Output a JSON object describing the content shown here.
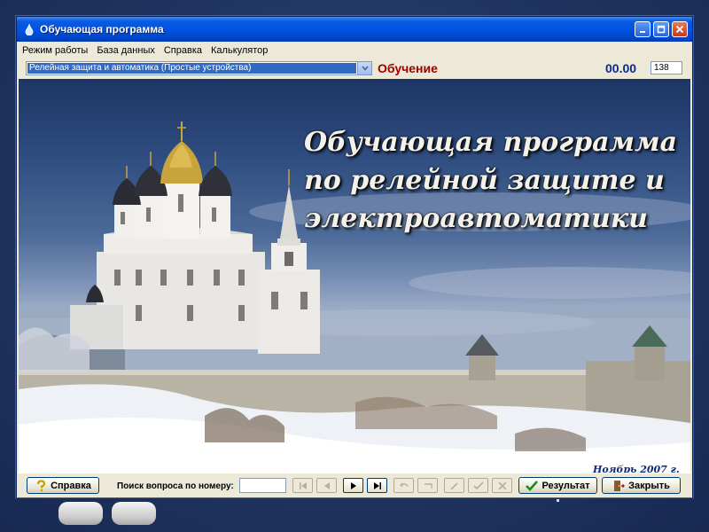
{
  "window": {
    "title": "Обучающая программа"
  },
  "menu": [
    "Режим работы",
    "База данных",
    "Справка",
    "Калькулятор"
  ],
  "toolbar": {
    "topic_value": "Релейная защита и автоматика (Простые устройства)",
    "mode_label": "Обучение",
    "timer": "00.00",
    "question_count": "138"
  },
  "content": {
    "heading_lines": [
      "Обучающая программа",
      "по релейной защите и",
      "электроавтоматики"
    ],
    "date": "Ноябрь 2007 г."
  },
  "bottom": {
    "help_label": "Справка",
    "search_label": "Поиск вопроса по номеру:",
    "search_value": "",
    "result_label": "Результат",
    "close_label": "Закрыть"
  },
  "colors": {
    "title_bar": "#0054e3",
    "mode_text": "#a00000",
    "timer_text": "#0a2a8a",
    "selection": "#316ac5",
    "desktop": "#1f3461"
  }
}
